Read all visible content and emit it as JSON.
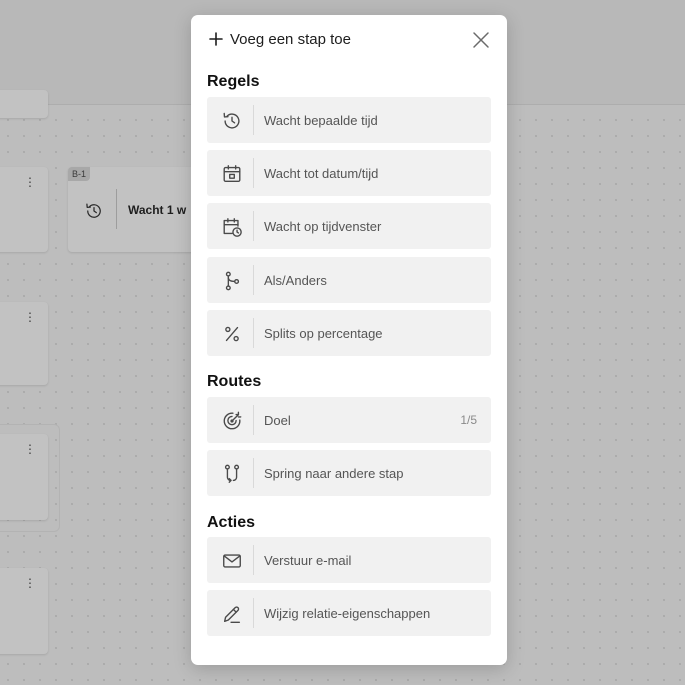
{
  "background": {
    "node_tag": "B-1",
    "node_text": "Wacht 1 w",
    "menu_glyph": "⋮"
  },
  "panel": {
    "title": "Voeg een stap toe",
    "sections": [
      {
        "title": "Regels",
        "items": [
          {
            "label": "Wacht bepaalde tijd",
            "icon": "clock-history-icon"
          },
          {
            "label": "Wacht tot datum/tijd",
            "icon": "calendar-icon"
          },
          {
            "label": "Wacht op tijdvenster",
            "icon": "calendar-clock-icon"
          },
          {
            "label": "Als/Anders",
            "icon": "branch-icon"
          },
          {
            "label": "Splits op percentage",
            "icon": "percent-icon"
          }
        ]
      },
      {
        "title": "Routes",
        "items": [
          {
            "label": "Doel",
            "icon": "target-icon",
            "count": "1/5"
          },
          {
            "label": "Spring naar andere stap",
            "icon": "jump-icon"
          }
        ]
      },
      {
        "title": "Acties",
        "items": [
          {
            "label": "Verstuur e-mail",
            "icon": "mail-icon"
          },
          {
            "label": "Wijzig relatie-eigenschappen",
            "icon": "pencil-icon"
          }
        ]
      }
    ]
  }
}
